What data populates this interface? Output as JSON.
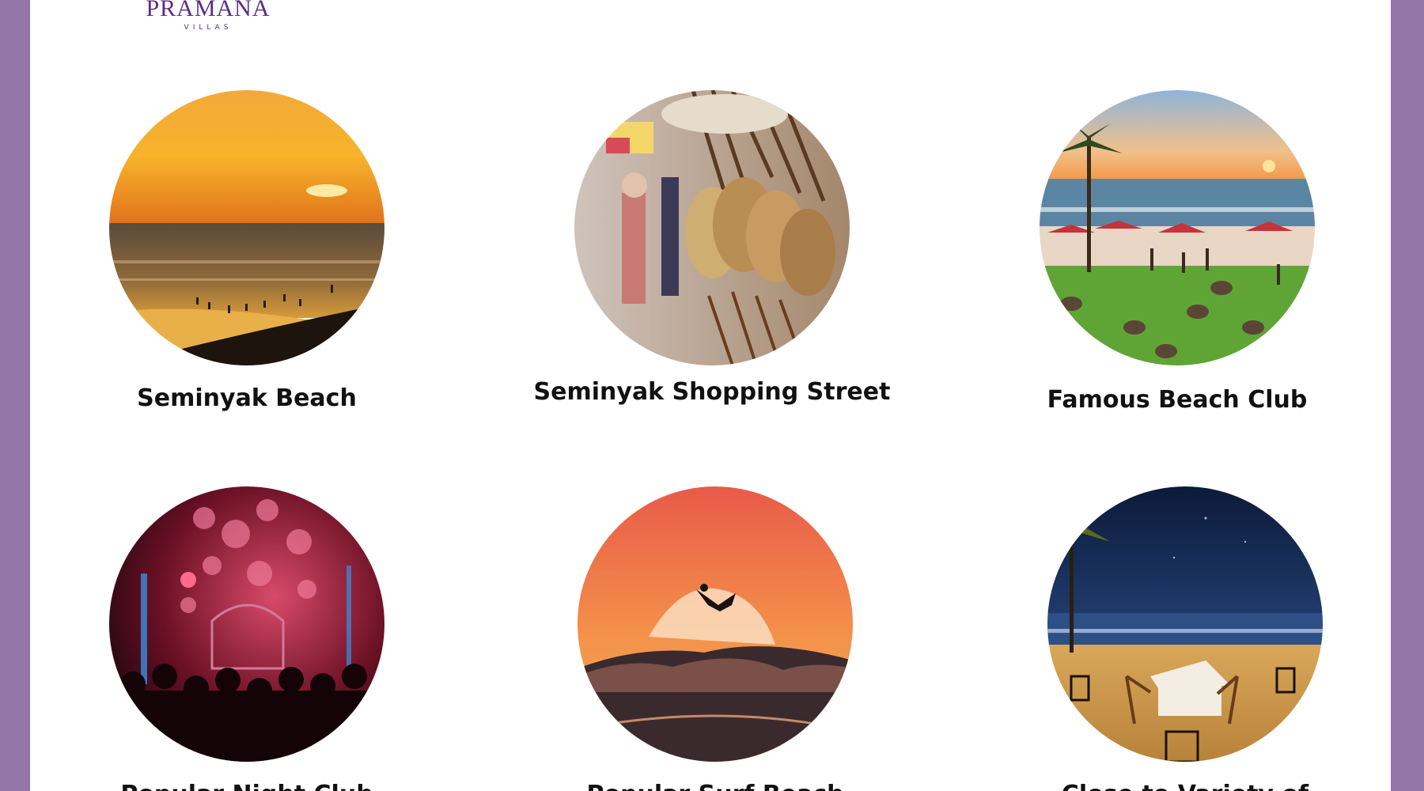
{
  "brand": {
    "name": "PRAMANA",
    "sub": "VILLAS",
    "color": "#5b2d82"
  },
  "page": {
    "border_color": "#9376a6"
  },
  "attractions": [
    {
      "label": "Seminyak Beach",
      "icon": "beach-sunset-photo"
    },
    {
      "label": "Seminyak Shopping Street",
      "icon": "market-bags-photo"
    },
    {
      "label": "Famous Beach Club",
      "icon": "beach-club-photo"
    },
    {
      "label": "Popular Night Club",
      "icon": "nightclub-photo"
    },
    {
      "label": "Popular Surf Beach",
      "icon": "surfer-photo"
    },
    {
      "label": "Close to Variety of",
      "icon": "beach-dinner-photo"
    }
  ]
}
